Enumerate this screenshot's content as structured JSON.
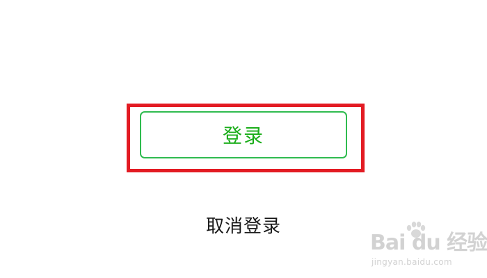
{
  "login_button": {
    "label": "登录"
  },
  "cancel": {
    "label": "取消登录"
  },
  "colors": {
    "highlight": "#e31b23",
    "login_border": "#2fbb4f",
    "login_text": "#1aad19",
    "cancel_text": "#1a1a1a"
  },
  "watermark": {
    "logo_text": "Bai du 经验",
    "url": "jingyan.baidu.com"
  }
}
